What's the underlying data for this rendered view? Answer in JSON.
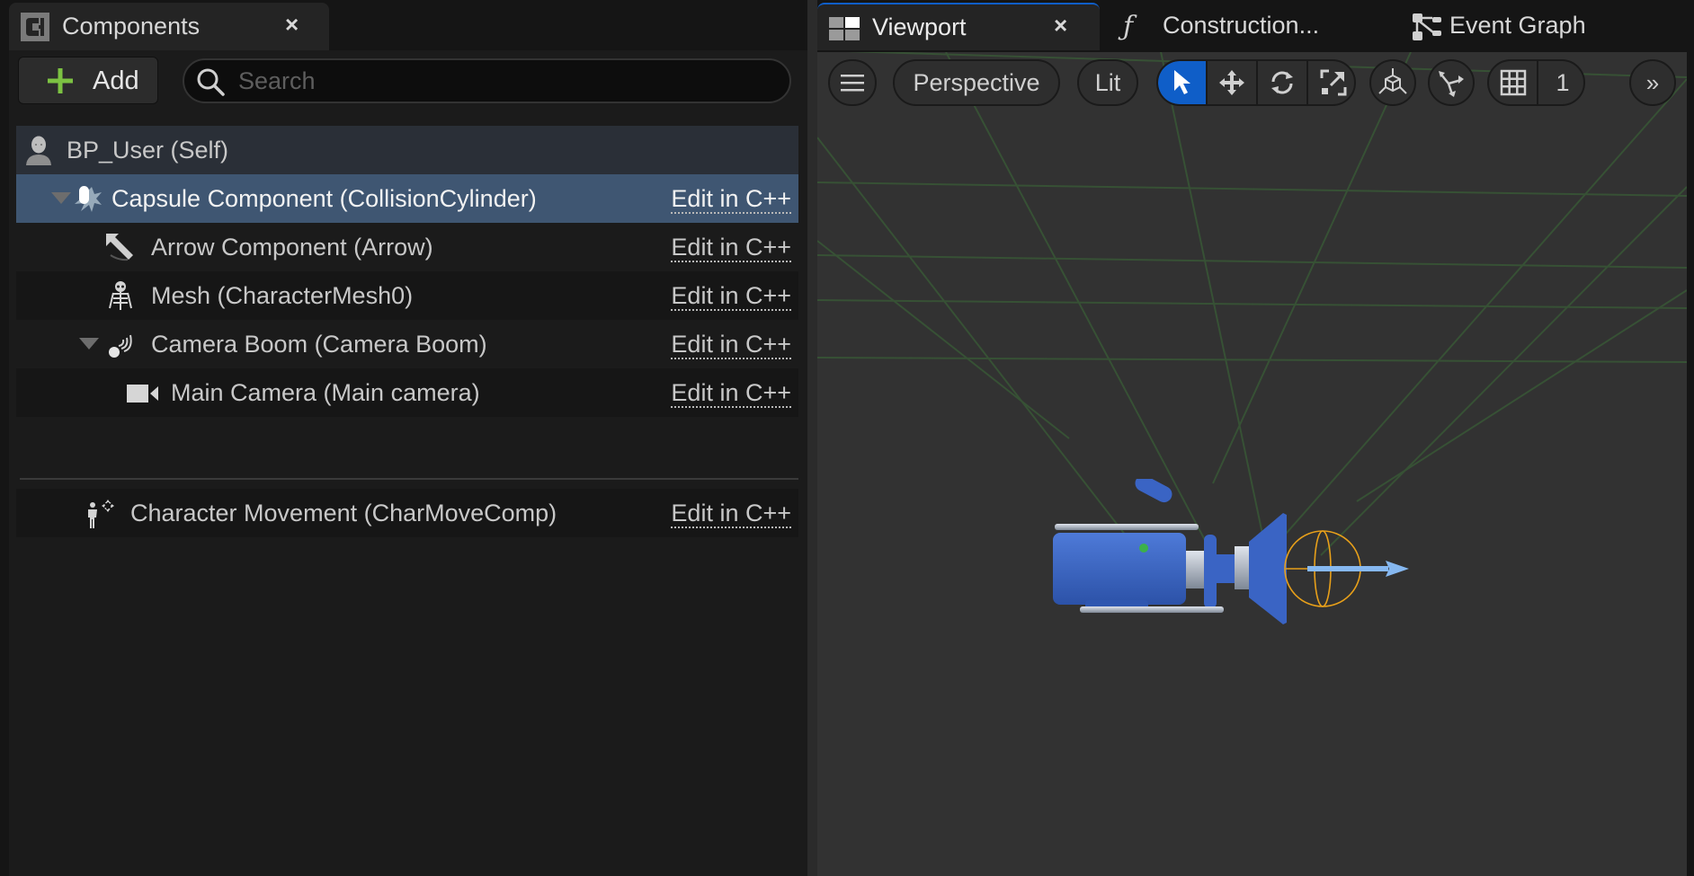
{
  "left_panel": {
    "tab": {
      "label": "Components",
      "icon": "components-tab-icon",
      "close": "×"
    },
    "toolbar": {
      "add_label": "Add",
      "search_placeholder": "Search",
      "search_value": ""
    },
    "tree": [
      {
        "label": "BP_User (Self)",
        "icon": "character-icon",
        "state": "self"
      },
      {
        "label": "Capsule Component (CollisionCylinder)",
        "icon": "capsule-icon",
        "expanded": true,
        "state": "selected",
        "action": "Edit in C++"
      },
      {
        "label": "Arrow Component (Arrow)",
        "icon": "arrow-component-icon",
        "action": "Edit in C++"
      },
      {
        "label": "Mesh (CharacterMesh0)",
        "icon": "skeletal-mesh-icon",
        "action": "Edit in C++"
      },
      {
        "label": "Camera Boom (Camera Boom)",
        "icon": "spring-arm-icon",
        "expanded": true,
        "action": "Edit in C++"
      },
      {
        "label": "Main Camera (Main camera)",
        "icon": "camera-icon",
        "action": "Edit in C++"
      },
      {
        "label": "Character Movement (CharMoveComp)",
        "icon": "character-movement-icon",
        "action": "Edit in C++"
      }
    ]
  },
  "right_panel": {
    "tabs": [
      {
        "label": "Viewport",
        "icon": "viewport-icon",
        "active": true,
        "close": "×"
      },
      {
        "label": "Construction...",
        "icon": "function-icon"
      },
      {
        "label": "Event Graph",
        "icon": "event-graph-icon"
      }
    ],
    "viewport_toolbar": {
      "menu_icon": "hamburger-menu-icon",
      "view_mode": "Perspective",
      "lighting_mode": "Lit",
      "transform_tools": [
        {
          "name": "select",
          "icon": "select-cursor-icon",
          "active": true
        },
        {
          "name": "translate",
          "icon": "translate-icon"
        },
        {
          "name": "rotate",
          "icon": "rotate-icon"
        },
        {
          "name": "scale",
          "icon": "scale-icon"
        }
      ],
      "surface_snapping_icon": "surface-snap-icon",
      "world_local_icon": "coordinate-space-icon",
      "grid_snap_value": "1",
      "overflow_icon": "chevron-double-right-icon"
    },
    "colors": {
      "accent_blue": "#0f5ec8",
      "grid_green": "#3a5a34",
      "capsule_orange": "#e8a01a",
      "arrow_blue": "#86b8f0",
      "camera_body": "#3a64c4"
    }
  }
}
